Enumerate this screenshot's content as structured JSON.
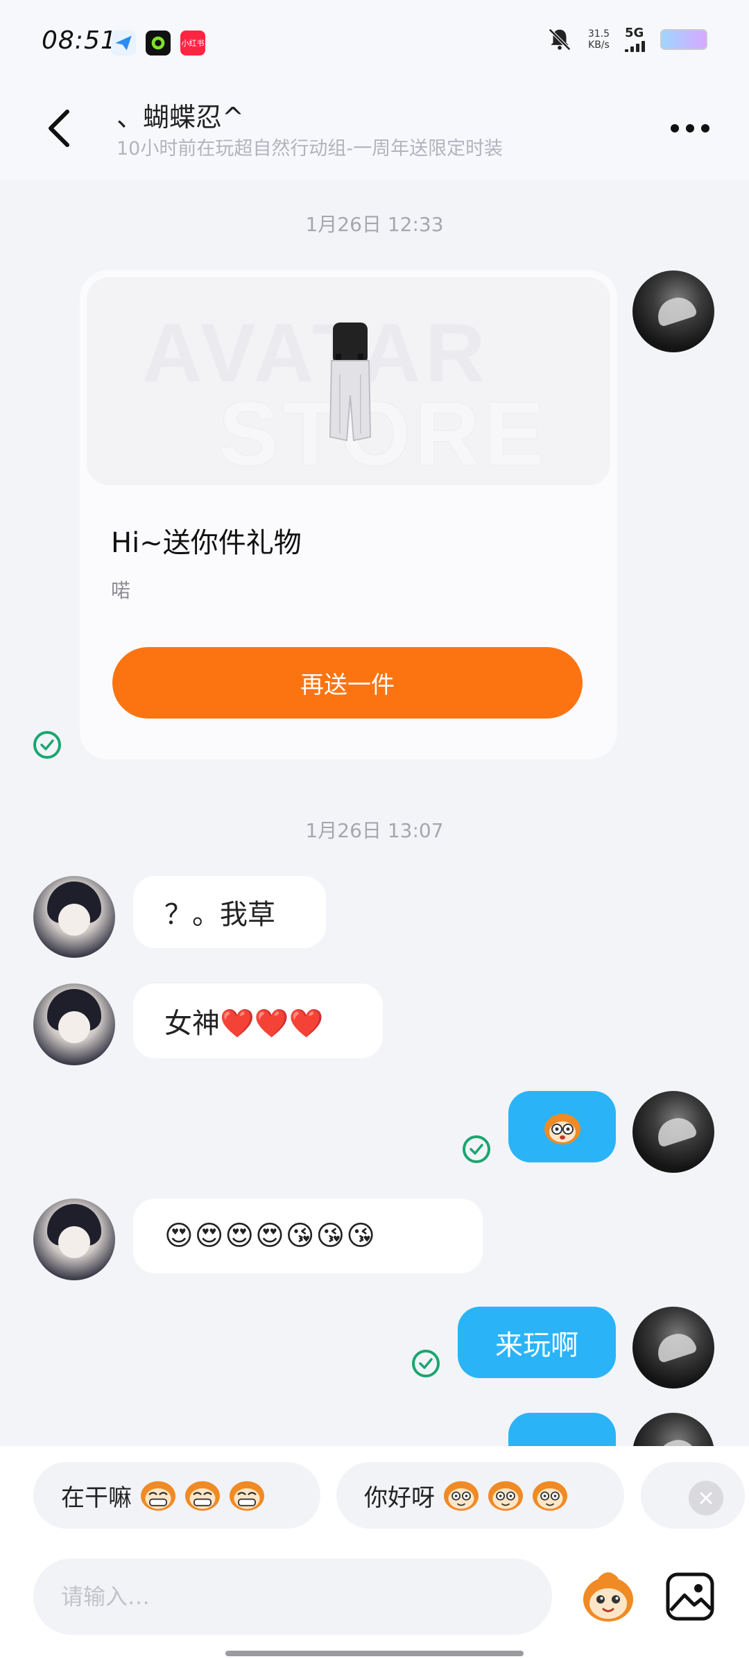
{
  "status_bar": {
    "time": "08:51",
    "app_icons": [
      "send-app-icon",
      "circle-app-icon",
      "xiaohongshu-app-icon"
    ],
    "xiaohongshu_label": "小红书",
    "net_speed_value": "31.5",
    "net_speed_unit": "KB/s",
    "network": "5G"
  },
  "header": {
    "name": "、蝴蝶忍^",
    "subtitle": "10小时前在玩超自然行动组-一周年送限定时装"
  },
  "messages": {
    "time1": "1月26日 12:33",
    "gift_card": {
      "banner_line1": "AVATAR",
      "banner_line2": "STORE",
      "title": "Hi~送你件礼物",
      "description": "喏",
      "button_label": "再送一件"
    },
    "time2": "1月26日 13:07",
    "msg1_text": "？。我草",
    "msg2_text": "女神❤️❤️❤️",
    "msg3_emoji": "monkey-sticker",
    "msg4_text": "😍😍😍😍😘😘😘",
    "msg5_text": "来玩啊"
  },
  "quick_replies": [
    {
      "text": "在干嘛",
      "emoji": "grin-monkey-icon"
    },
    {
      "text": "你好呀",
      "emoji": "smile-monkey-icon"
    }
  ],
  "composer": {
    "placeholder": "请输入…"
  },
  "colors": {
    "accent_orange": "#fc7412",
    "bubble_blue": "#2ab4f7",
    "check_green": "#1aa66f",
    "background": "#f2f4f8"
  }
}
